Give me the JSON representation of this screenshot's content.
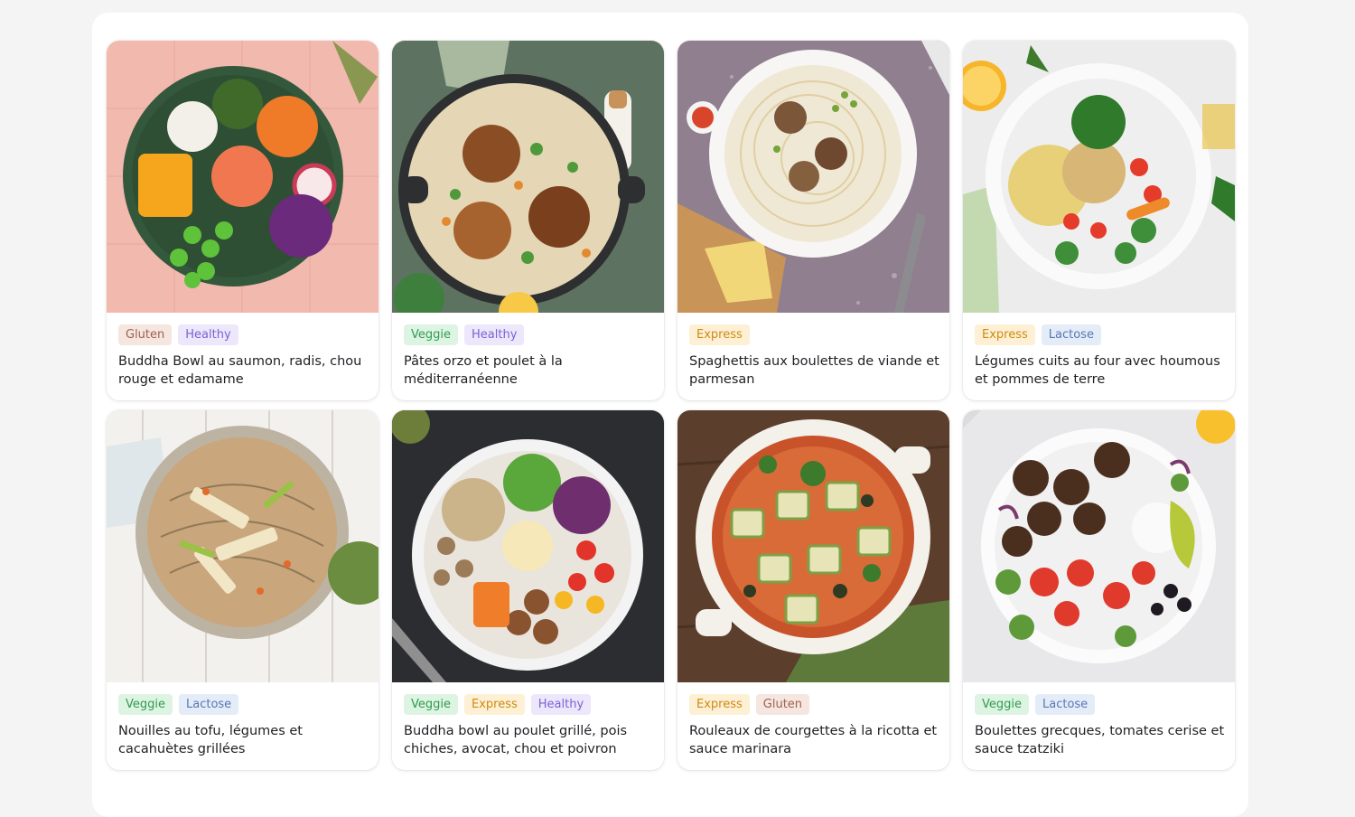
{
  "recipes": [
    {
      "title": "Buddha Bowl au saumon, radis, chou rouge et edamame",
      "tags": [
        {
          "label": "Gluten",
          "kind": "gluten"
        },
        {
          "label": "Healthy",
          "kind": "healthy"
        }
      ],
      "image": "salmon-poke-bowl-image"
    },
    {
      "title": "Pâtes orzo et poulet à la méditerranéenne",
      "tags": [
        {
          "label": "Veggie",
          "kind": "veggie"
        },
        {
          "label": "Healthy",
          "kind": "healthy"
        }
      ],
      "image": "orzo-chicken-pan-image"
    },
    {
      "title": "Spaghettis aux boulettes de viande et parmesan",
      "tags": [
        {
          "label": "Express",
          "kind": "express"
        }
      ],
      "image": "spaghetti-meatballs-image"
    },
    {
      "title": "Légumes cuits au four avec houmous et pommes de terre",
      "tags": [
        {
          "label": "Express",
          "kind": "express"
        },
        {
          "label": "Lactose",
          "kind": "lactose"
        }
      ],
      "image": "roasted-vegetables-bowl-image"
    },
    {
      "title": "Nouilles au tofu, légumes et cacahuètes grillées",
      "tags": [
        {
          "label": "Veggie",
          "kind": "veggie"
        },
        {
          "label": "Lactose",
          "kind": "lactose"
        }
      ],
      "image": "tofu-noodles-image"
    },
    {
      "title": "Buddha bowl au poulet grillé, pois chiches, avocat, chou et poivron",
      "tags": [
        {
          "label": "Veggie",
          "kind": "veggie"
        },
        {
          "label": "Express",
          "kind": "express"
        },
        {
          "label": "Healthy",
          "kind": "healthy"
        }
      ],
      "image": "chicken-buddha-bowl-image"
    },
    {
      "title": "Rouleaux de courgettes à la ricotta et sauce marinara",
      "tags": [
        {
          "label": "Express",
          "kind": "express"
        },
        {
          "label": "Gluten",
          "kind": "gluten"
        }
      ],
      "image": "zucchini-rolls-image"
    },
    {
      "title": "Boulettes grecques, tomates cerise et sauce tzatziki",
      "tags": [
        {
          "label": "Veggie",
          "kind": "veggie"
        },
        {
          "label": "Lactose",
          "kind": "lactose"
        }
      ],
      "image": "greek-meatballs-image"
    }
  ],
  "tag_colors": {
    "gluten": {
      "bg": "#f5e6df",
      "fg": "#a0614f"
    },
    "healthy": {
      "bg": "#ece7fb",
      "fg": "#7b61d6"
    },
    "veggie": {
      "bg": "#def4e3",
      "fg": "#2f9b4e"
    },
    "express": {
      "bg": "#fdf0d4",
      "fg": "#d08a12"
    },
    "lactose": {
      "bg": "#e4ecf8",
      "fg": "#5679b3"
    }
  }
}
